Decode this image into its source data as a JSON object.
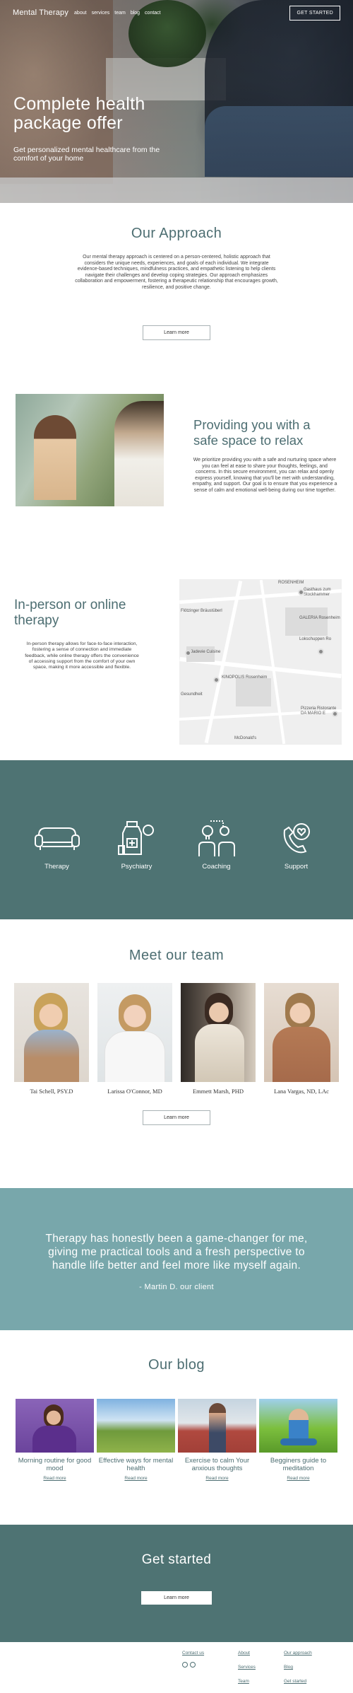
{
  "nav": {
    "logo": "Mental Therapy",
    "links": [
      "about",
      "services",
      "team",
      "blog",
      "contact"
    ],
    "cta": "GET STARTED"
  },
  "hero": {
    "title_line1": "Complete health",
    "title_line2": "package offer",
    "subtitle": "Get personalized mental healthcare from the comfort of your home"
  },
  "approach": {
    "title": "Our Approach",
    "body": "Our mental therapy approach is centered on a person-centered, holistic approach that considers the unique needs, experiences, and goals of each individual. We integrate evidence-based techniques, mindfulness practices, and empathetic listening to help clients navigate their challenges and develop coping strategies. Our approach emphasizes collaboration and empowerment, fostering a therapeutic relationship that encourages growth, resilience, and positive change.",
    "button": "Learn more"
  },
  "safe_space": {
    "title": "Providing you with a safe space to relax",
    "body": "We prioritize providing you with a safe and nurturing space where you can feel at ease to share your thoughts, feelings, and concerns. In this secure environment, you can relax and openly express yourself, knowing that you'll be met with understanding, empathy, and support. Our goal is to ensure that you experience a sense of calm and emotional well-being during our time together."
  },
  "in_person": {
    "title": "In-person or online therapy",
    "body": "In-person therapy allows for face-to-face interaction, fostering a sense of connection and immediate feedback, while online therapy offers the convenience of accessing support from the comfort of your own space, making it more accessible and flexible.",
    "map_labels": [
      "ROSENHEIM",
      "Gasthaus zum Stockhammer",
      "Flötzinger Bräustüberl",
      "GALERIA Rosenheim",
      "Jadevie Cuisine",
      "Lokschuppen Ro",
      "KINOPOLIS Rosenheim",
      "Pizzeria Ristorante DA MARIO E",
      "McDonald's",
      "Gesundheit"
    ]
  },
  "services": [
    {
      "label": "Therapy",
      "icon": "sofa-icon"
    },
    {
      "label": "Psychiatry",
      "icon": "medicine-icon"
    },
    {
      "label": "Coaching",
      "icon": "lightbulb-gears-icon"
    },
    {
      "label": "Support",
      "icon": "phone-heart-icon"
    }
  ],
  "team": {
    "title": "Meet our team",
    "members": [
      {
        "name": "Tai Schell, PSY.D"
      },
      {
        "name": "Larissa O'Connor, MD"
      },
      {
        "name": "Emmett Marsh, PHD"
      },
      {
        "name": "Lana Vargas, ND, LAc"
      }
    ],
    "button": "Learn more"
  },
  "testimonial": {
    "quote": "Therapy has honestly been a game-changer for me, giving me practical tools and a fresh perspective to handle life better and feel more like myself again.",
    "author": "- Martin D. our client"
  },
  "blog": {
    "title": "Our blog",
    "posts": [
      {
        "title": "Morning routine for good mood",
        "link": "Read more"
      },
      {
        "title": "Effective ways for mental health",
        "link": "Read more"
      },
      {
        "title": "Exercise to calm Your anxious thoughts",
        "link": "Read more"
      },
      {
        "title": "Begginers guide to meditation",
        "link": "Read more"
      }
    ]
  },
  "get_started": {
    "title": "Get started",
    "button": "Learn more"
  },
  "footer": {
    "contact": "Contact us",
    "about": "About",
    "approach": "Our approach",
    "services": "Services",
    "blog": "Blog",
    "team": "Team",
    "get_started": "Get started"
  },
  "colors": {
    "teal_dark": "#4e7373",
    "teal_light": "#78a7ab",
    "heading": "#4d6e72"
  }
}
